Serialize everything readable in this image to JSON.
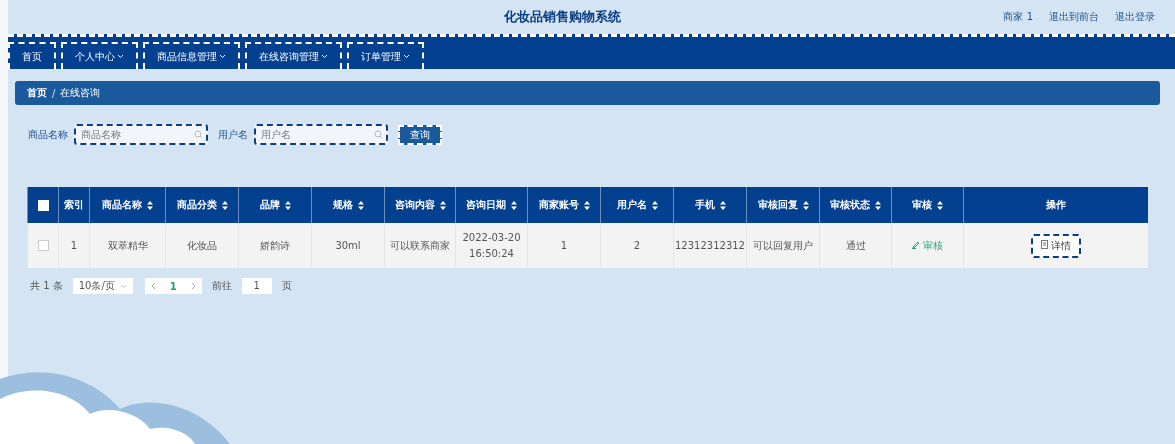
{
  "header": {
    "title": "化妆品销售购物系统",
    "user_links": [
      "商家 1",
      "退出到前台",
      "退出登录"
    ]
  },
  "nav": [
    {
      "label": "首页",
      "dropdown": false
    },
    {
      "label": "个人中心",
      "dropdown": true
    },
    {
      "label": "商品信息管理",
      "dropdown": true
    },
    {
      "label": "在线咨询管理",
      "dropdown": true
    },
    {
      "label": "订单管理",
      "dropdown": true
    }
  ],
  "breadcrumb": [
    "首页",
    "在线咨询"
  ],
  "breadcrumb_separator": "/",
  "search": {
    "fields": [
      {
        "label": "商品名称",
        "placeholder": "商品名称"
      },
      {
        "label": "用户名",
        "placeholder": "用户名"
      }
    ],
    "button": "查询"
  },
  "table": {
    "select_all": {
      "checked": false
    },
    "columns": [
      {
        "label": "索引",
        "sortable": false
      },
      {
        "label": "商品名称",
        "sortable": true
      },
      {
        "label": "商品分类",
        "sortable": true
      },
      {
        "label": "品牌",
        "sortable": true
      },
      {
        "label": "规格",
        "sortable": true
      },
      {
        "label": "咨询内容",
        "sortable": true
      },
      {
        "label": "咨询日期",
        "sortable": true
      },
      {
        "label": "商家账号",
        "sortable": true
      },
      {
        "label": "用户名",
        "sortable": true
      },
      {
        "label": "手机",
        "sortable": true
      },
      {
        "label": "审核回复",
        "sortable": true
      },
      {
        "label": "审核状态",
        "sortable": true
      },
      {
        "label": "审核",
        "sortable": true
      },
      {
        "label": "操作",
        "sortable": false
      }
    ],
    "rows": [
      {
        "checked": false,
        "cells": [
          "1",
          "双萃精华",
          "化妆品",
          "娇韵诗",
          "30ml",
          "可以联系商家",
          "2022-03-20 16:50:24",
          "1",
          "2",
          "12312312312",
          "可以回复用户",
          "通过"
        ],
        "review_link": "审核",
        "detail_button": "详情"
      }
    ]
  },
  "pagination": {
    "total": "共 1 条",
    "page_size": "10条/页",
    "pages": [
      {
        "label": "1",
        "selected": true
      }
    ],
    "goto_label": "前往",
    "goto_value": "1",
    "page_unit": "页"
  }
}
